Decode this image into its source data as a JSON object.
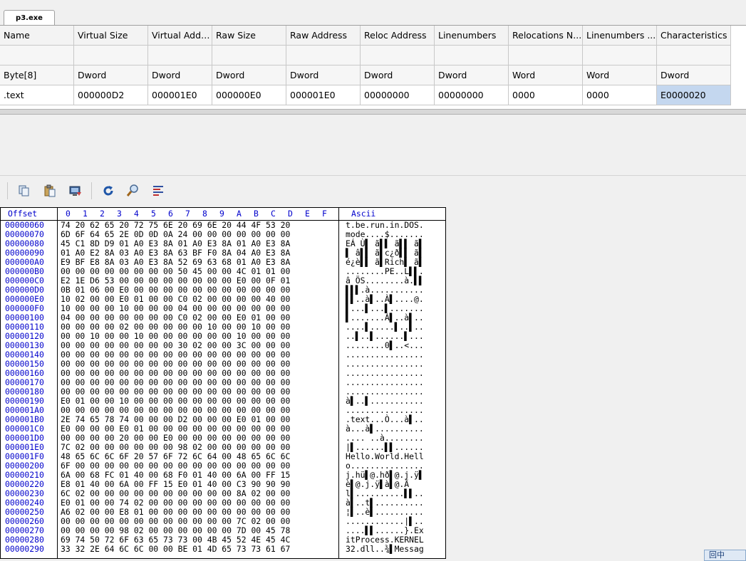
{
  "tab": {
    "label": "p3.exe"
  },
  "grid": {
    "columns": [
      "Name",
      "Virtual Size",
      "Virtual Addr...",
      "Raw Size",
      "Raw Address",
      "Reloc Address",
      "Linenumbers",
      "Relocations N...",
      "Linenumbers ...",
      "Characteristics"
    ],
    "types": [
      "Byte[8]",
      "Dword",
      "Dword",
      "Dword",
      "Dword",
      "Dword",
      "Dword",
      "Word",
      "Word",
      "Dword"
    ],
    "rows": [
      [
        ".text",
        "000000D2",
        "000001E0",
        "000000E0",
        "000001E0",
        "00000000",
        "00000000",
        "0000",
        "0000",
        "E0000020"
      ]
    ]
  },
  "toolbar": {
    "buttons": [
      "copy-icon",
      "paste-icon",
      "write-memory-icon",
      "refresh-icon",
      "search-icon",
      "hex-view-icon"
    ]
  },
  "hex": {
    "offset_header": "Offset",
    "columns_header": [
      "0",
      "1",
      "2",
      "3",
      "4",
      "5",
      "6",
      "7",
      "8",
      "9",
      "A",
      "B",
      "C",
      "D",
      "E",
      "F"
    ],
    "ascii_header": "Ascii",
    "rows": [
      {
        "offset": "00000060",
        "bytes": "74 20 62 65 20 72 75 6E 20 69 6E 20 44 4F 53 20",
        "ascii": "t.be.run.in.DOS."
      },
      {
        "offset": "00000070",
        "bytes": "6D 6F 64 65 2E 0D 0D 0A 24 00 00 00 00 00 00 00",
        "ascii": "mode....$......."
      },
      {
        "offset": "00000080",
        "bytes": "45 C1 8D D9 01 A0 E3 8A 01 A0 E3 8A 01 A0 E3 8A",
        "ascii": "EÁ Ù▌ ã▌▌ ã▌▌ ã▌"
      },
      {
        "offset": "00000090",
        "bytes": "01 A0 E2 8A 03 A0 E3 8A 63 BF F0 8A 04 A0 E3 8A",
        "ascii": "▌ â▌▌ ã▌c¿ð▌▌ ã▌"
      },
      {
        "offset": "000000A0",
        "bytes": "E9 BF E8 8A 03 A0 E3 8A 52 69 63 68 01 A0 E3 8A",
        "ascii": "é¿è▌▌ ã▌Rich▌ ã▌"
      },
      {
        "offset": "000000B0",
        "bytes": "00 00 00 00 00 00 00 00 50 45 00 00 4C 01 01 00",
        "ascii": "........PE..L▌▌."
      },
      {
        "offset": "000000C0",
        "bytes": "E2 1E D6 53 00 00 00 00 00 00 00 00 E0 00 0F 01",
        "ascii": "â ÖS........à.▌▌"
      },
      {
        "offset": "000000D0",
        "bytes": "0B 01 06 00 E0 00 00 00 00 00 00 00 00 00 00 00",
        "ascii": "▌▌▌.à..........."
      },
      {
        "offset": "000000E0",
        "bytes": "10 02 00 00 E0 01 00 00 C0 02 00 00 00 00 40 00",
        "ascii": "▌▌..à▌..À▌....@."
      },
      {
        "offset": "000000F0",
        "bytes": "10 00 00 00 10 00 00 00 04 00 00 00 00 00 00 00",
        "ascii": "▌...▌...▌......."
      },
      {
        "offset": "00000100",
        "bytes": "04 00 00 00 00 00 00 00 C0 02 00 00 E0 01 00 00",
        "ascii": "▌.......À▌..à▌.."
      },
      {
        "offset": "00000110",
        "bytes": "00 00 00 00 02 00 00 00 00 00 10 00 00 10 00 00",
        "ascii": "....▌.....▌..▌.."
      },
      {
        "offset": "00000120",
        "bytes": "00 00 10 00 00 10 00 00 00 00 00 00 10 00 00 00",
        "ascii": "..▌..▌......▌..."
      },
      {
        "offset": "00000130",
        "bytes": "00 00 00 00 00 00 00 00 30 02 00 00 3C 00 00 00",
        "ascii": "........0▌..<..."
      },
      {
        "offset": "00000140",
        "bytes": "00 00 00 00 00 00 00 00 00 00 00 00 00 00 00 00",
        "ascii": "................"
      },
      {
        "offset": "00000150",
        "bytes": "00 00 00 00 00 00 00 00 00 00 00 00 00 00 00 00",
        "ascii": "................"
      },
      {
        "offset": "00000160",
        "bytes": "00 00 00 00 00 00 00 00 00 00 00 00 00 00 00 00",
        "ascii": "................"
      },
      {
        "offset": "00000170",
        "bytes": "00 00 00 00 00 00 00 00 00 00 00 00 00 00 00 00",
        "ascii": "................"
      },
      {
        "offset": "00000180",
        "bytes": "00 00 00 00 00 00 00 00 00 00 00 00 00 00 00 00",
        "ascii": "................"
      },
      {
        "offset": "00000190",
        "bytes": "E0 01 00 00 10 00 00 00 00 00 00 00 00 00 00 00",
        "ascii": "à▌..▌..........."
      },
      {
        "offset": "000001A0",
        "bytes": "00 00 00 00 00 00 00 00 00 00 00 00 00 00 00 00",
        "ascii": "................"
      },
      {
        "offset": "000001B0",
        "bytes": "2E 74 65 78 74 00 00 00 D2 00 00 00 E0 01 00 00",
        "ascii": ".text...Ò...à▌.."
      },
      {
        "offset": "000001C0",
        "bytes": "E0 00 00 00 E0 01 00 00 00 00 00 00 00 00 00 00",
        "ascii": "à...à▌.........."
      },
      {
        "offset": "000001D0",
        "bytes": "00 00 00 00 20 00 00 E0 00 00 00 00 00 00 00 00",
        "ascii": ".... ..à........"
      },
      {
        "offset": "000001E0",
        "bytes": "7C 02 00 00 00 00 00 00 98 02 00 00 00 00 00 00",
        "ascii": "|▌......▌▌......"
      },
      {
        "offset": "000001F0",
        "bytes": "48 65 6C 6C 6F 20 57 6F 72 6C 64 00 48 65 6C 6C",
        "ascii": "Hello.World.Hell"
      },
      {
        "offset": "00000200",
        "bytes": "6F 00 00 00 00 00 00 00 00 00 00 00 00 00 00 00",
        "ascii": "o..............."
      },
      {
        "offset": "00000210",
        "bytes": "6A 00 68 FC 01 40 00 68 F0 01 40 00 6A 00 FF 15",
        "ascii": "j.hü▌@.hð▌@.j.ÿ▌"
      },
      {
        "offset": "00000220",
        "bytes": "E8 01 40 00 6A 00 FF 15 E0 01 40 00 C3 90 90 90",
        "ascii": "è▌@.j.ÿ▌à▌@.Ã"
      },
      {
        "offset": "00000230",
        "bytes": "6C 02 00 00 00 00 00 00 00 00 00 00 8A 02 00 00",
        "ascii": "l▌..........▌▌.."
      },
      {
        "offset": "00000240",
        "bytes": "E0 01 00 00 74 02 00 00 00 00 00 00 00 00 00 00",
        "ascii": "à▌..t▌.........."
      },
      {
        "offset": "00000250",
        "bytes": "A6 02 00 00 E8 01 00 00 00 00 00 00 00 00 00 00",
        "ascii": "¦▌..è▌.........."
      },
      {
        "offset": "00000260",
        "bytes": "00 00 00 00 00 00 00 00 00 00 00 00 7C 02 00 00",
        "ascii": "............|▌.."
      },
      {
        "offset": "00000270",
        "bytes": "00 00 00 00 98 02 00 00 00 00 00 00 7D 00 45 78",
        "ascii": "....▌▌......}.Ex"
      },
      {
        "offset": "00000280",
        "bytes": "69 74 50 72 6F 63 65 73 73 00 4B 45 52 4E 45 4C",
        "ascii": "itProcess.KERNEL"
      },
      {
        "offset": "00000290",
        "bytes": "33 32 2E 64 6C 6C 00 00 BE 01 4D 65 73 73 61 67",
        "ascii": "32.dll..¾▌Messag"
      }
    ]
  },
  "statusbar": {
    "label": "回中"
  }
}
